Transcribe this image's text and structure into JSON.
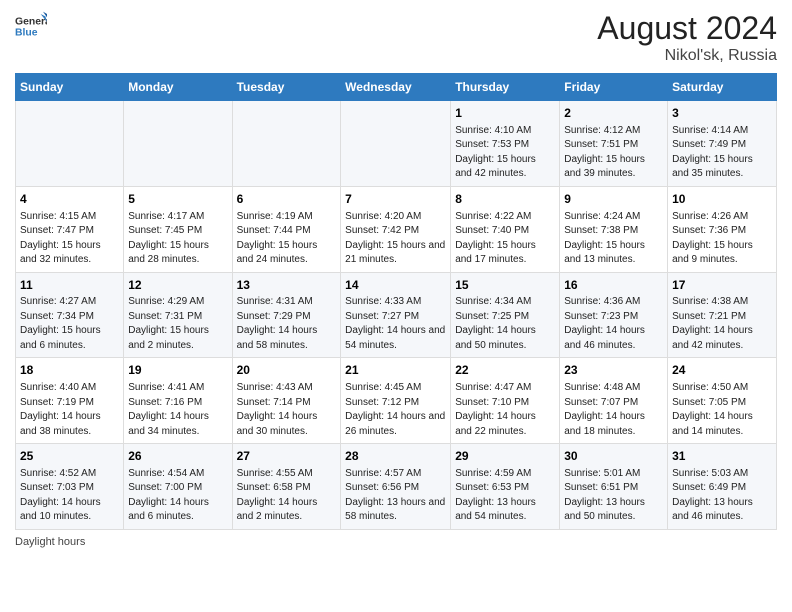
{
  "header": {
    "logo_general": "General",
    "logo_blue": "Blue",
    "month_year": "August 2024",
    "location": "Nikol'sk, Russia"
  },
  "days_of_week": [
    "Sunday",
    "Monday",
    "Tuesday",
    "Wednesday",
    "Thursday",
    "Friday",
    "Saturday"
  ],
  "weeks": [
    [
      {
        "day": "",
        "info": ""
      },
      {
        "day": "",
        "info": ""
      },
      {
        "day": "",
        "info": ""
      },
      {
        "day": "",
        "info": ""
      },
      {
        "day": "1",
        "info": "Sunrise: 4:10 AM\nSunset: 7:53 PM\nDaylight: 15 hours and 42 minutes."
      },
      {
        "day": "2",
        "info": "Sunrise: 4:12 AM\nSunset: 7:51 PM\nDaylight: 15 hours and 39 minutes."
      },
      {
        "day": "3",
        "info": "Sunrise: 4:14 AM\nSunset: 7:49 PM\nDaylight: 15 hours and 35 minutes."
      }
    ],
    [
      {
        "day": "4",
        "info": "Sunrise: 4:15 AM\nSunset: 7:47 PM\nDaylight: 15 hours and 32 minutes."
      },
      {
        "day": "5",
        "info": "Sunrise: 4:17 AM\nSunset: 7:45 PM\nDaylight: 15 hours and 28 minutes."
      },
      {
        "day": "6",
        "info": "Sunrise: 4:19 AM\nSunset: 7:44 PM\nDaylight: 15 hours and 24 minutes."
      },
      {
        "day": "7",
        "info": "Sunrise: 4:20 AM\nSunset: 7:42 PM\nDaylight: 15 hours and 21 minutes."
      },
      {
        "day": "8",
        "info": "Sunrise: 4:22 AM\nSunset: 7:40 PM\nDaylight: 15 hours and 17 minutes."
      },
      {
        "day": "9",
        "info": "Sunrise: 4:24 AM\nSunset: 7:38 PM\nDaylight: 15 hours and 13 minutes."
      },
      {
        "day": "10",
        "info": "Sunrise: 4:26 AM\nSunset: 7:36 PM\nDaylight: 15 hours and 9 minutes."
      }
    ],
    [
      {
        "day": "11",
        "info": "Sunrise: 4:27 AM\nSunset: 7:34 PM\nDaylight: 15 hours and 6 minutes."
      },
      {
        "day": "12",
        "info": "Sunrise: 4:29 AM\nSunset: 7:31 PM\nDaylight: 15 hours and 2 minutes."
      },
      {
        "day": "13",
        "info": "Sunrise: 4:31 AM\nSunset: 7:29 PM\nDaylight: 14 hours and 58 minutes."
      },
      {
        "day": "14",
        "info": "Sunrise: 4:33 AM\nSunset: 7:27 PM\nDaylight: 14 hours and 54 minutes."
      },
      {
        "day": "15",
        "info": "Sunrise: 4:34 AM\nSunset: 7:25 PM\nDaylight: 14 hours and 50 minutes."
      },
      {
        "day": "16",
        "info": "Sunrise: 4:36 AM\nSunset: 7:23 PM\nDaylight: 14 hours and 46 minutes."
      },
      {
        "day": "17",
        "info": "Sunrise: 4:38 AM\nSunset: 7:21 PM\nDaylight: 14 hours and 42 minutes."
      }
    ],
    [
      {
        "day": "18",
        "info": "Sunrise: 4:40 AM\nSunset: 7:19 PM\nDaylight: 14 hours and 38 minutes."
      },
      {
        "day": "19",
        "info": "Sunrise: 4:41 AM\nSunset: 7:16 PM\nDaylight: 14 hours and 34 minutes."
      },
      {
        "day": "20",
        "info": "Sunrise: 4:43 AM\nSunset: 7:14 PM\nDaylight: 14 hours and 30 minutes."
      },
      {
        "day": "21",
        "info": "Sunrise: 4:45 AM\nSunset: 7:12 PM\nDaylight: 14 hours and 26 minutes."
      },
      {
        "day": "22",
        "info": "Sunrise: 4:47 AM\nSunset: 7:10 PM\nDaylight: 14 hours and 22 minutes."
      },
      {
        "day": "23",
        "info": "Sunrise: 4:48 AM\nSunset: 7:07 PM\nDaylight: 14 hours and 18 minutes."
      },
      {
        "day": "24",
        "info": "Sunrise: 4:50 AM\nSunset: 7:05 PM\nDaylight: 14 hours and 14 minutes."
      }
    ],
    [
      {
        "day": "25",
        "info": "Sunrise: 4:52 AM\nSunset: 7:03 PM\nDaylight: 14 hours and 10 minutes."
      },
      {
        "day": "26",
        "info": "Sunrise: 4:54 AM\nSunset: 7:00 PM\nDaylight: 14 hours and 6 minutes."
      },
      {
        "day": "27",
        "info": "Sunrise: 4:55 AM\nSunset: 6:58 PM\nDaylight: 14 hours and 2 minutes."
      },
      {
        "day": "28",
        "info": "Sunrise: 4:57 AM\nSunset: 6:56 PM\nDaylight: 13 hours and 58 minutes."
      },
      {
        "day": "29",
        "info": "Sunrise: 4:59 AM\nSunset: 6:53 PM\nDaylight: 13 hours and 54 minutes."
      },
      {
        "day": "30",
        "info": "Sunrise: 5:01 AM\nSunset: 6:51 PM\nDaylight: 13 hours and 50 minutes."
      },
      {
        "day": "31",
        "info": "Sunrise: 5:03 AM\nSunset: 6:49 PM\nDaylight: 13 hours and 46 minutes."
      }
    ]
  ],
  "footer": {
    "daylight_label": "Daylight hours"
  }
}
